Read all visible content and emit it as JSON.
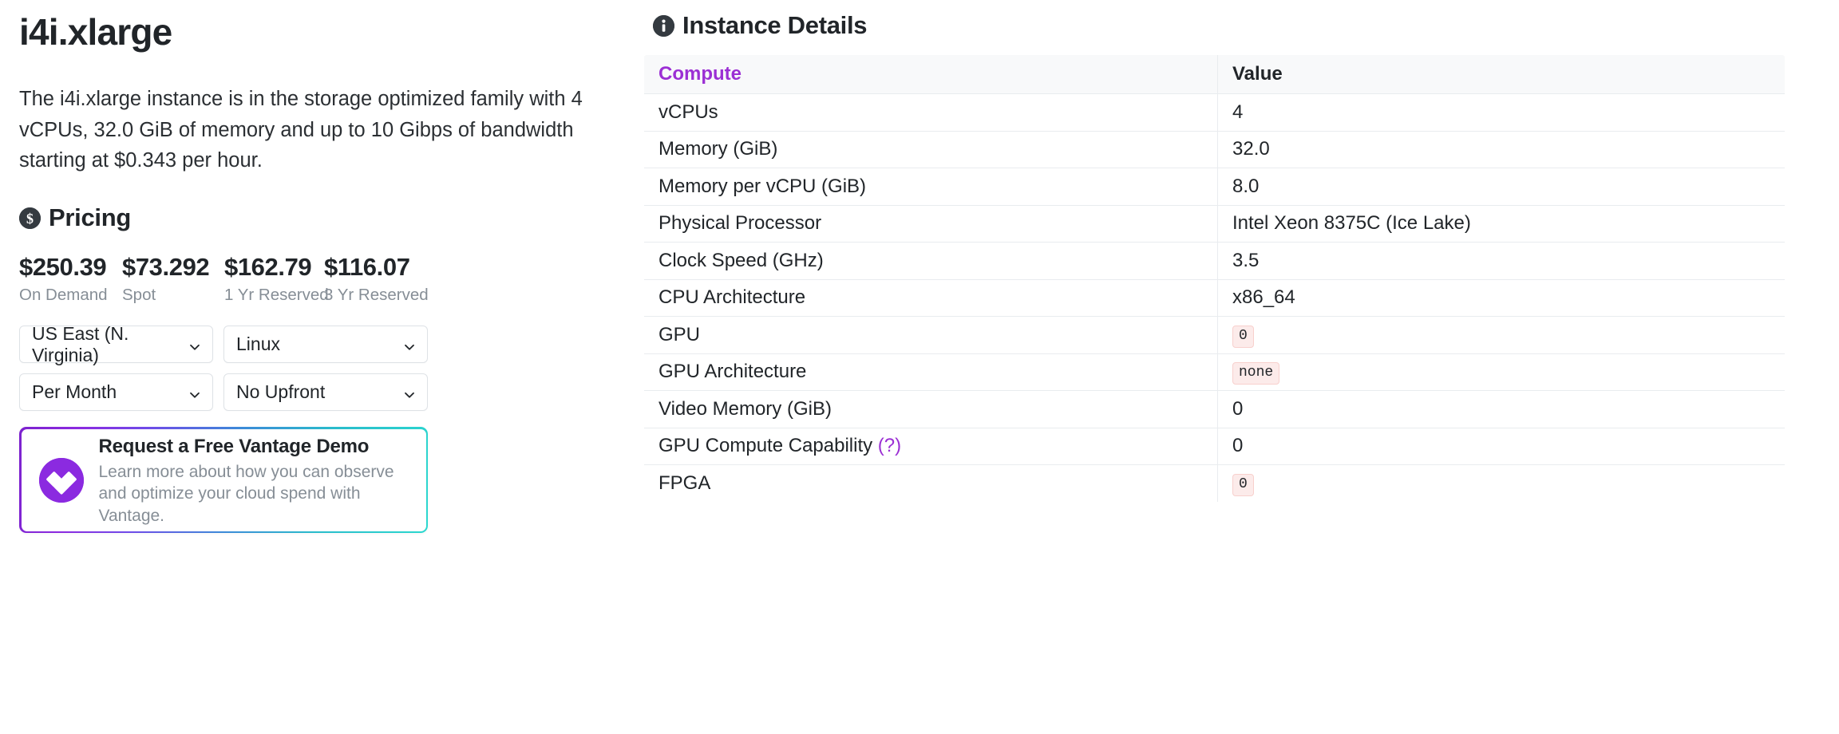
{
  "left": {
    "instance_title": "i4i.xlarge",
    "instance_description": "The i4i.xlarge instance is in the storage optimized family with 4 vCPUs, 32.0 GiB of memory and up to 10 Gibps of bandwidth starting at $0.343 per hour.",
    "pricing": {
      "section_title": "Pricing",
      "section_icon": "dollar-circle-icon",
      "items": [
        {
          "amount": "$250.39",
          "label": "On Demand"
        },
        {
          "amount": "$73.292",
          "label": "Spot"
        },
        {
          "amount": "$162.79",
          "label": "1 Yr Reserved"
        },
        {
          "amount": "$116.07",
          "label": "3 Yr Reserved"
        }
      ],
      "selects": {
        "region": "US East (N. Virginia)",
        "os": "Linux",
        "period": "Per Month",
        "upfront": "No Upfront"
      }
    },
    "promo": {
      "title": "Request a Free Vantage Demo",
      "subtitle": "Learn more about how you can observe and optimize your cloud spend with Vantage.",
      "logo_icon": "vantage-logo-icon",
      "border_gradient_from": "#7c22ce",
      "border_gradient_to": "#2bd8cf",
      "logo_color": "#8b2ae0"
    }
  },
  "right": {
    "section_title": "Instance Details",
    "section_icon": "info-circle-icon",
    "table": {
      "headers": [
        "Compute",
        "Value"
      ],
      "header_accent_color": "#9b2fd4",
      "rows": [
        {
          "label": "vCPUs",
          "value": "4",
          "type": "text"
        },
        {
          "label": "Memory (GiB)",
          "value": "32.0",
          "type": "text"
        },
        {
          "label": "Memory per vCPU (GiB)",
          "value": "8.0",
          "type": "text"
        },
        {
          "label": "Physical Processor",
          "value": "Intel Xeon 8375C (Ice Lake)",
          "type": "text"
        },
        {
          "label": "Clock Speed (GHz)",
          "value": "3.5",
          "type": "text"
        },
        {
          "label": "CPU Architecture",
          "value": "x86_64",
          "type": "text"
        },
        {
          "label": "GPU",
          "value": "0",
          "type": "badge"
        },
        {
          "label": "GPU Architecture",
          "value": "none",
          "type": "badge"
        },
        {
          "label": "Video Memory (GiB)",
          "value": "0",
          "type": "text"
        },
        {
          "label": "GPU Compute Capability",
          "label_suffix": "(?)",
          "value": "0",
          "type": "text"
        },
        {
          "label": "FPGA",
          "value": "0",
          "type": "badge"
        }
      ]
    }
  }
}
